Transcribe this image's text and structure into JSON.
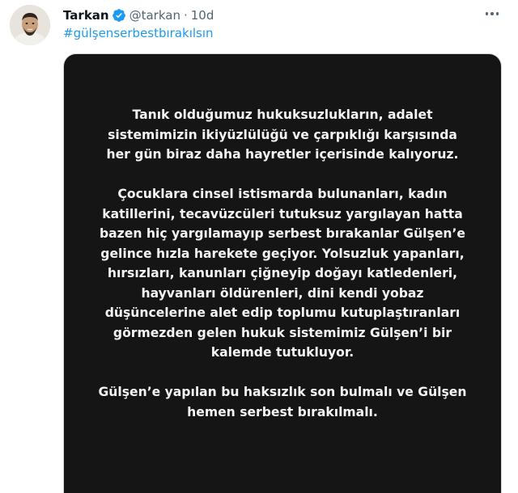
{
  "tweet": {
    "author": {
      "name": "Tarkan",
      "handle": "@tarkan",
      "separator": "·",
      "time": "10d",
      "avatar_icon": "user-avatar",
      "verified_icon": "verified-badge-icon"
    },
    "hashtag": "#gülşenserbestbırakılsın",
    "more_icon": "more-options-icon",
    "colors": {
      "link": "#1d9bf0",
      "secondary_text": "#536471",
      "media_background": "#151515",
      "media_text": "#f3f3f3"
    },
    "media_text": {
      "paragraphs": [
        {
          "lines": [
            "Tanık olduğumuz hukuksuzlukların, adalet",
            "sistemimizin ikiyüzlülüğü ve çarpıklığı karşısında",
            "her gün biraz daha hayretler içerisinde kalıyoruz."
          ]
        },
        {
          "lines": [
            "Çocuklara cinsel istismarda bulunanları, kadın",
            "katillerini, tecavüzcüleri tutuksuz yargılayan hatta",
            "bazen hiç yargılamayıp serbest bırakanlar Gülşen’e",
            "gelince hızla harekete geçiyor. Yolsuzluk yapanları,",
            "hırsızları, kanunları çiğneyip doğayı katledenleri,",
            "hayvanları öldürenleri, dini kendi yobaz",
            "düşüncelerine alet edip toplumu kutuplaştıranları",
            "görmezden gelen hukuk sistemimiz Gülşen’i bir",
            "kalemde tutukluyor."
          ]
        },
        {
          "lines": [
            "Gülşen’e yapılan bu haksızlık son bulmalı ve Gülşen",
            "hemen serbest bırakılmalı."
          ]
        }
      ]
    }
  }
}
